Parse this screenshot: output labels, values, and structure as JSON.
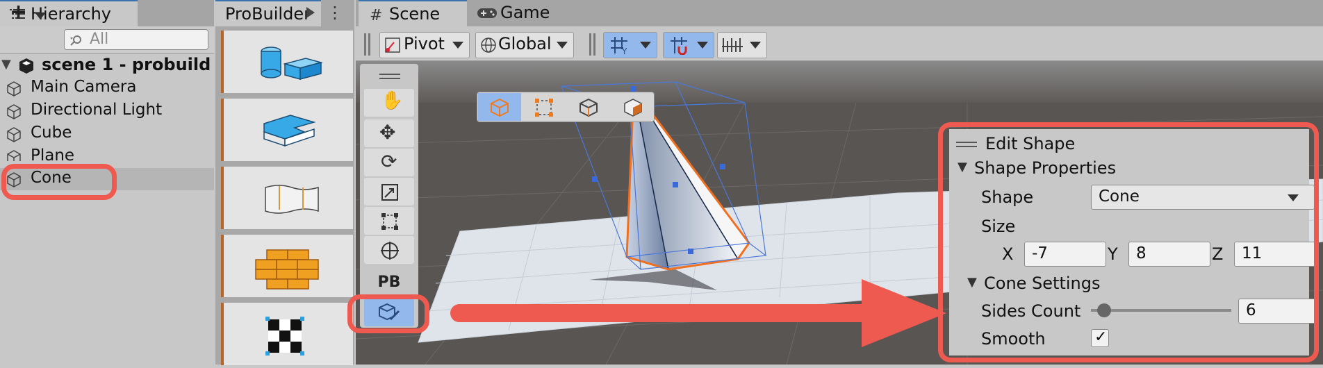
{
  "hierarchy": {
    "tab_label": "Hierarchy",
    "search_placeholder": "All",
    "add_label": "+",
    "scene_name": "scene 1 - probuild",
    "items": [
      "Main Camera",
      "Directional Light",
      "Cube",
      "Plane",
      "Cone"
    ]
  },
  "probuilder": {
    "tab_label": "ProBuilder",
    "pb_label": "PB"
  },
  "scene_view": {
    "tabs": [
      "Scene",
      "Game"
    ],
    "pivot_label": "Pivot",
    "global_label": "Global"
  },
  "edit_shape": {
    "title": "Edit Shape",
    "shape_properties_label": "Shape Properties",
    "shape_label": "Shape",
    "shape_value": "Cone",
    "size_label": "Size",
    "x_label": "X",
    "x_value": "-7",
    "y_label": "Y",
    "y_value": "8",
    "z_label": "Z",
    "z_value": "11",
    "cone_settings_label": "Cone Settings",
    "sides_count_label": "Sides Count",
    "sides_count_value": "6",
    "sides_slider_fraction": 0.05,
    "smooth_label": "Smooth",
    "smooth_checked": true
  },
  "colors": {
    "highlight": "#ef5a50",
    "accent_blue": "#3a72b0",
    "active_tool": "#93b9ec",
    "probuilder_orange": "#b7652b"
  }
}
